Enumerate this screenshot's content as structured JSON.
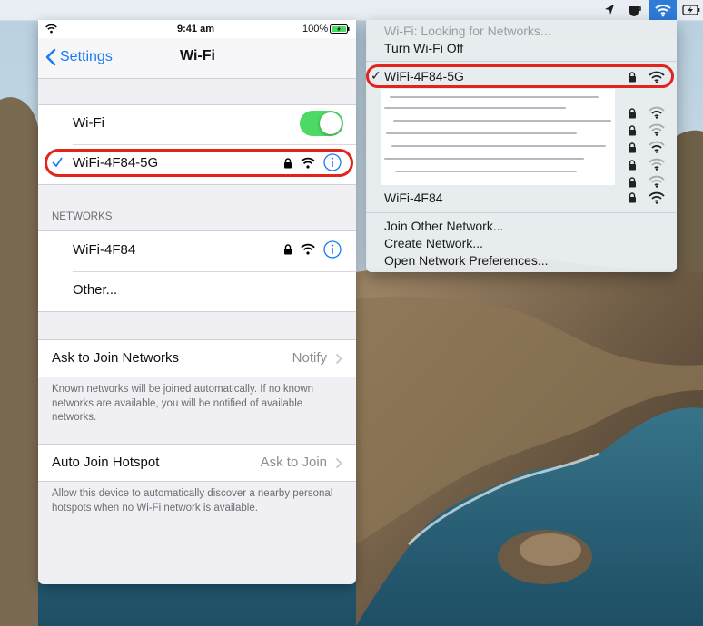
{
  "menubar": {
    "icons": [
      "location-arrow-icon",
      "app-icon",
      "wifi-icon",
      "battery-charging-icon"
    ]
  },
  "mac_wifi_menu": {
    "status": "Wi-Fi: Looking for Networks...",
    "turn_off": "Turn Wi-Fi Off",
    "connected_network": "WiFi-4F84-5G",
    "other_network": "WiFi-4F84",
    "join_other": "Join Other Network...",
    "create_network": "Create Network...",
    "open_prefs": "Open Network Preferences..."
  },
  "ios": {
    "status_bar": {
      "time": "9:41 am",
      "battery": "100%"
    },
    "nav": {
      "back_label": "Settings",
      "title": "Wi-Fi"
    },
    "wifi_row_label": "Wi-Fi",
    "wifi_enabled": true,
    "connected_network": "WiFi-4F84-5G",
    "networks_header": "NETWORKS",
    "networks": [
      "WiFi-4F84"
    ],
    "other_label": "Other...",
    "ask_to_join": {
      "label": "Ask to Join Networks",
      "value": "Notify",
      "caption": "Known networks will be joined automatically. If no known networks are available, you will be notified of available networks."
    },
    "auto_join": {
      "label": "Auto Join Hotspot",
      "value": "Ask to Join",
      "caption": "Allow this device to automatically discover a nearby personal hotspots when no Wi-Fi network is available."
    }
  },
  "colors": {
    "accent_blue": "#2f7bd8",
    "ios_link": "#1a7cf5",
    "toggle_on": "#4cd964",
    "annotation_red": "#e2241c"
  }
}
